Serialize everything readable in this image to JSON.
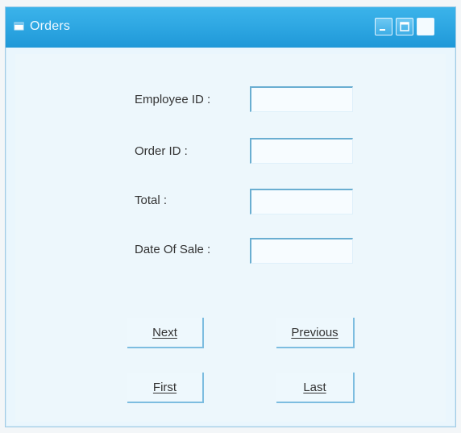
{
  "window": {
    "title": "Orders"
  },
  "titlebar_buttons": {
    "minimize_icon": "minimize-icon",
    "maximize_icon": "maximize-icon",
    "close_icon": "close-icon"
  },
  "form": {
    "employee_id_label": "Employee ID :",
    "employee_id_value": "",
    "order_id_label": "Order ID :",
    "order_id_value": "",
    "total_label": "Total :",
    "total_value": "",
    "date_of_sale_label": "Date Of Sale :",
    "date_of_sale_value": ""
  },
  "buttons": {
    "next": "Next",
    "previous": "Previous",
    "first": "First",
    "last": "Last"
  },
  "colors": {
    "titlebar": "#2fa8e3",
    "window_bg": "#eaf6fd",
    "field_border": "#6aaed1"
  }
}
